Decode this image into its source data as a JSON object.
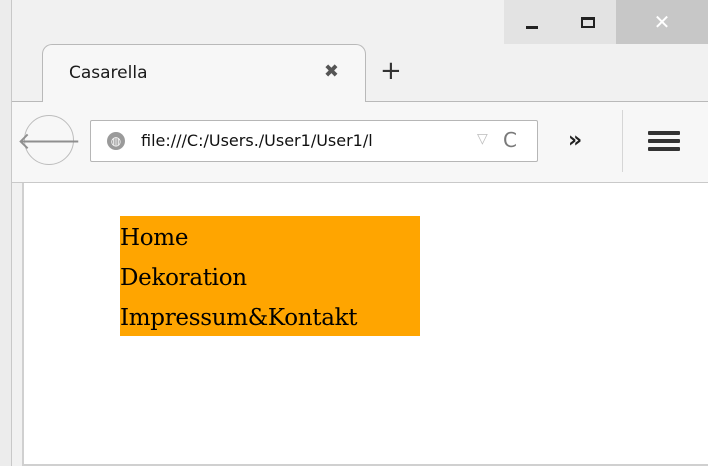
{
  "window": {
    "controls": [
      "minimize",
      "maximize",
      "close"
    ],
    "close_glyph": "✕"
  },
  "tab": {
    "title": "Casarella",
    "close_glyph": "✖",
    "new_tab_glyph": "+"
  },
  "navbar": {
    "back_glyph": "🡐",
    "url": "file:///C:/Users./User1/User1/l",
    "dropdown_glyph": "▽",
    "reload_glyph": "C",
    "overflow_glyph": "»",
    "icons": [
      "back-icon",
      "globe-icon",
      "dropdown-icon",
      "reload-icon",
      "overflow-icon",
      "menu-icon"
    ]
  },
  "page": {
    "menu": [
      {
        "label": "Home"
      },
      {
        "label": "Dekoration"
      },
      {
        "label": "Impressum&Kontakt"
      }
    ],
    "menu_background": "#ffa500"
  }
}
